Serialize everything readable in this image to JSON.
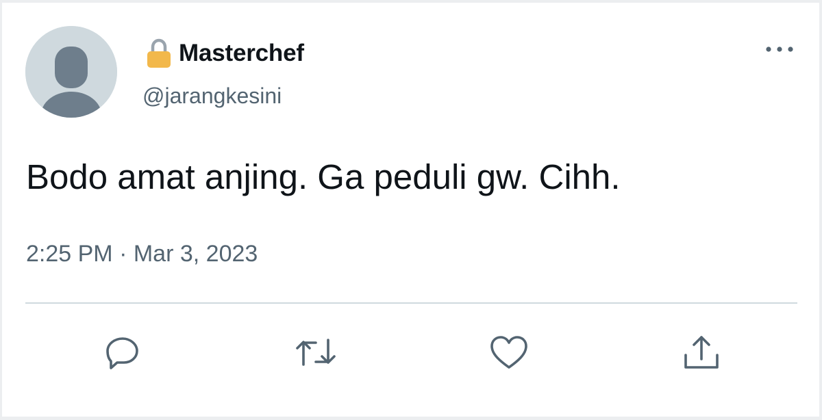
{
  "tweet": {
    "display_name": "Masterchef",
    "handle": "@jarangkesini",
    "text": "Bodo amat anjing. Ga peduli gw. Cihh.",
    "time": "2:25 PM",
    "separator": "·",
    "date": "Mar 3, 2023"
  },
  "icons": {
    "avatar": "default-avatar-icon",
    "lock": "lock-icon",
    "more": "more-options-icon",
    "reply": "reply-icon",
    "retweet": "retweet-icon",
    "like": "like-icon",
    "share": "share-icon"
  },
  "colors": {
    "text": "#0f1419",
    "secondary": "#536471",
    "avatar_bg": "#cfd9de",
    "avatar_figure": "#6e7e8c",
    "lock": "#f2b84b",
    "divider": "#cfd9de"
  }
}
